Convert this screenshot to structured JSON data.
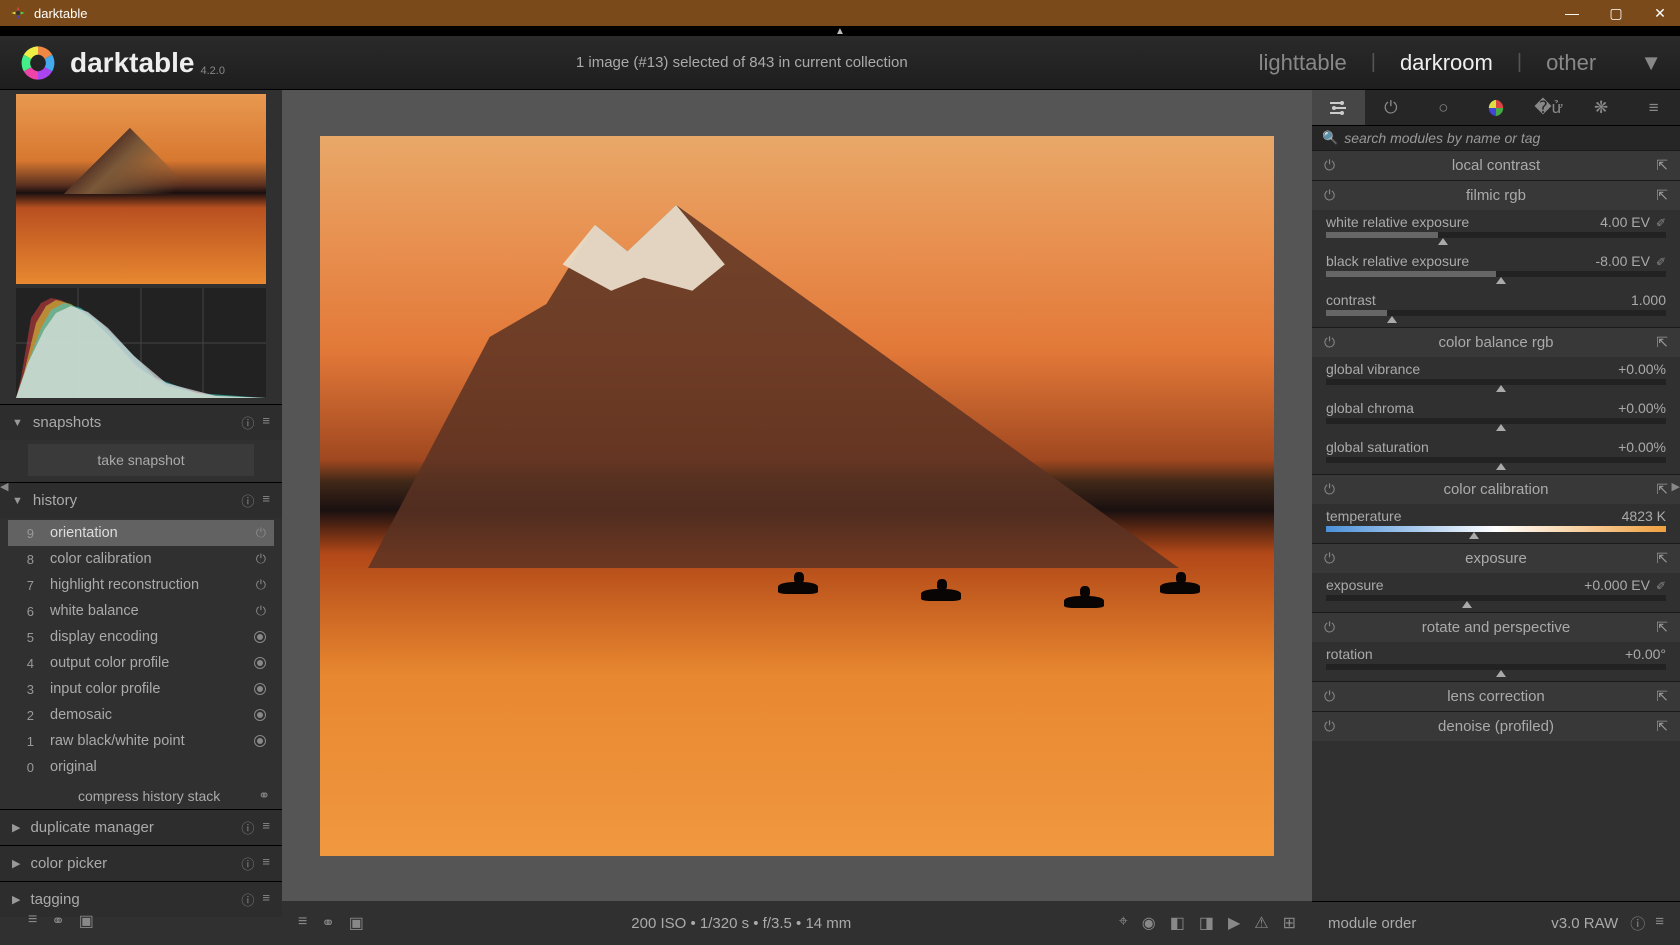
{
  "window": {
    "title": "darktable"
  },
  "app": {
    "name": "darktable",
    "version": "4.2.0"
  },
  "header": {
    "status": "1 image (#13) selected of 843 in current collection",
    "nav": {
      "lighttable": "lighttable",
      "darkroom": "darkroom",
      "other": "other",
      "active": "darkroom"
    }
  },
  "left": {
    "snapshots": {
      "title": "snapshots",
      "button": "take snapshot"
    },
    "history": {
      "title": "history",
      "compress": "compress history stack",
      "items": [
        {
          "n": "9",
          "label": "orientation",
          "selected": true,
          "indicator": "power"
        },
        {
          "n": "8",
          "label": "color calibration",
          "indicator": "power"
        },
        {
          "n": "7",
          "label": "highlight reconstruction",
          "indicator": "power"
        },
        {
          "n": "6",
          "label": "white balance",
          "indicator": "power"
        },
        {
          "n": "5",
          "label": "display encoding",
          "indicator": "dot"
        },
        {
          "n": "4",
          "label": "output color profile",
          "indicator": "dot"
        },
        {
          "n": "3",
          "label": "input color profile",
          "indicator": "dot"
        },
        {
          "n": "2",
          "label": "demosaic",
          "indicator": "dot"
        },
        {
          "n": "1",
          "label": "raw black/white point",
          "indicator": "dot"
        },
        {
          "n": "0",
          "label": "original",
          "indicator": "none"
        }
      ]
    },
    "duplicate": {
      "title": "duplicate manager"
    },
    "picker": {
      "title": "color picker"
    },
    "tagging": {
      "title": "tagging"
    }
  },
  "center": {
    "footer": {
      "info": "200 ISO • 1/320 s • f/3.5 • 14 mm"
    }
  },
  "right": {
    "search_placeholder": "search modules by name or tag",
    "modules": {
      "local_contrast": {
        "title": "local contrast"
      },
      "filmic": {
        "title": "filmic rgb",
        "white_label": "white relative exposure",
        "white_val": "4.00 EV",
        "black_label": "black relative exposure",
        "black_val": "-8.00 EV",
        "contrast_label": "contrast",
        "contrast_val": "1.000"
      },
      "colorbalance": {
        "title": "color balance rgb",
        "vibrance_label": "global vibrance",
        "vibrance_val": "+0.00%",
        "chroma_label": "global chroma",
        "chroma_val": "+0.00%",
        "saturation_label": "global saturation",
        "saturation_val": "+0.00%"
      },
      "colorcal": {
        "title": "color calibration",
        "temp_label": "temperature",
        "temp_val": "4823 K"
      },
      "exposure": {
        "title": "exposure",
        "exp_label": "exposure",
        "exp_val": "+0.000 EV"
      },
      "rotate": {
        "title": "rotate and perspective",
        "rot_label": "rotation",
        "rot_val": "+0.00°"
      },
      "lens": {
        "title": "lens correction"
      },
      "denoise": {
        "title": "denoise (profiled)"
      }
    },
    "footer": {
      "label": "module order",
      "value": "v3.0 RAW"
    }
  }
}
